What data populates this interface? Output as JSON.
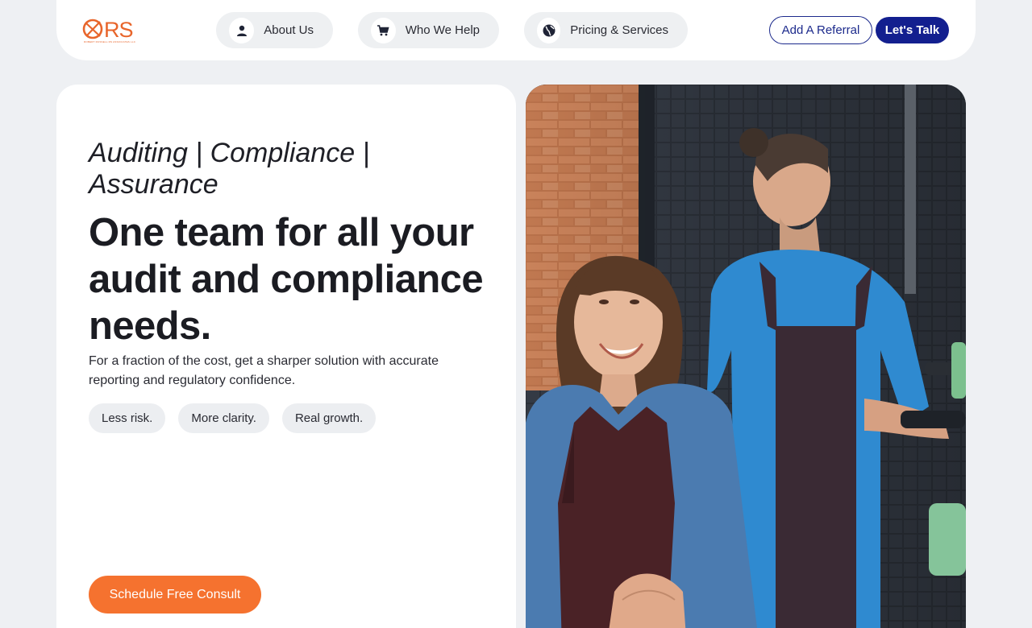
{
  "brand": {
    "logo_text": "RS",
    "tagline": "ROBERT RUSSELL RS ASSOCIATES LLC",
    "accent_color": "#e8652b"
  },
  "nav": {
    "items": [
      {
        "label": "About Us",
        "icon": "user-icon"
      },
      {
        "label": "Who We Help",
        "icon": "cart-icon"
      },
      {
        "label": "Pricing & Services",
        "icon": "globe-icon"
      }
    ],
    "referral_label": "Add A Referral",
    "talk_label": "Let's Talk",
    "primary_color": "#131f8f"
  },
  "hero": {
    "kicker": "Auditing | Compliance | Assurance",
    "title": "One team for all your audit and compliance needs.",
    "subtitle": "For a fraction of the cost, get a sharper solution with accurate reporting and regulatory confidence.",
    "chips": [
      "Less risk.",
      "More clarity.",
      "Real growth."
    ],
    "cta_label": "Schedule Free Consult",
    "cta_color": "#f5722f"
  },
  "photo": {
    "description_icon": "photo-image"
  }
}
